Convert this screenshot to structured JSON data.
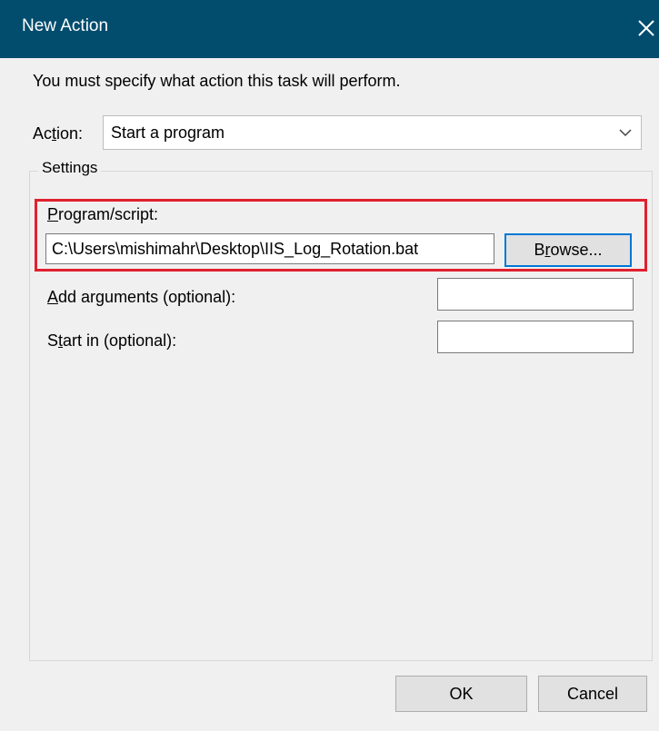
{
  "window": {
    "title": "New Action",
    "close_icon": "close-icon"
  },
  "instruction": "You must specify what action this task will perform.",
  "action": {
    "label_pre": "Ac",
    "label_mnemonic": "t",
    "label_post": "ion:",
    "selected": "Start a program",
    "dropdown_icon": "chevron-down-icon"
  },
  "settings": {
    "legend": "Settings",
    "program": {
      "label_mnemonic": "P",
      "label_rest": "rogram/script:",
      "value": "C:\\Users\\mishimahr\\Desktop\\IIS_Log_Rotation.bat",
      "browse_pre": "B",
      "browse_mnemonic": "r",
      "browse_post": "owse..."
    },
    "arguments": {
      "label_mnemonic": "A",
      "label_rest": "dd arguments (optional):",
      "value": ""
    },
    "start_in": {
      "label_pre": "S",
      "label_mnemonic": "t",
      "label_post": "art in (optional):",
      "value": ""
    }
  },
  "buttons": {
    "ok": "OK",
    "cancel": "Cancel"
  },
  "colors": {
    "titlebar": "#024c6e",
    "highlight": "#e0202e",
    "focus": "#0078d7"
  }
}
